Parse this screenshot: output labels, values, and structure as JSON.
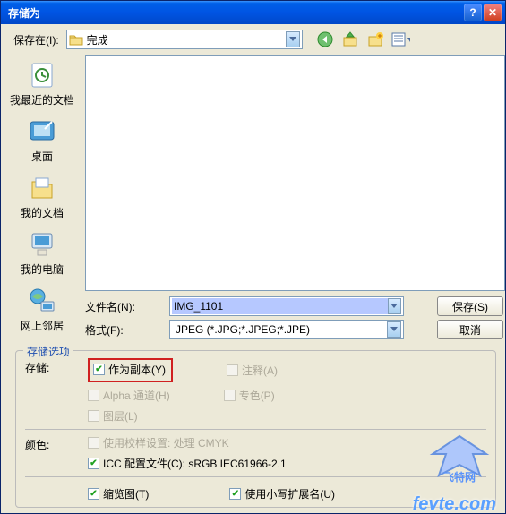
{
  "window": {
    "title": "存储为"
  },
  "toolbar": {
    "save_in_label": "保存在(I):",
    "save_in_value": "完成"
  },
  "places": [
    {
      "label": "我最近的文档"
    },
    {
      "label": "桌面"
    },
    {
      "label": "我的文档"
    },
    {
      "label": "我的电脑"
    },
    {
      "label": "网上邻居"
    }
  ],
  "form": {
    "filename_label": "文件名(N):",
    "filename_value": "IMG_1101",
    "format_label": "格式(F):",
    "format_value": "JPEG (*.JPG;*.JPEG;*.JPE)",
    "save_btn": "保存(S)",
    "cancel_btn": "取消"
  },
  "options": {
    "group_title": "存储选项",
    "storage_label": "存储:",
    "as_copy": "作为副本(Y)",
    "annotations": "注释(A)",
    "alpha": "Alpha 通道(H)",
    "spot": "专色(P)",
    "layers": "图层(L)",
    "color_label": "颜色:",
    "proof": "使用校样设置: 处理 CMYK",
    "icc": "ICC 配置文件(C): sRGB IEC61966-2.1",
    "thumbnail": "缩览图(T)",
    "lowercase_ext": "使用小写扩展名(U)"
  },
  "watermark": {
    "text": "飞特网",
    "url": "fevte.com"
  }
}
